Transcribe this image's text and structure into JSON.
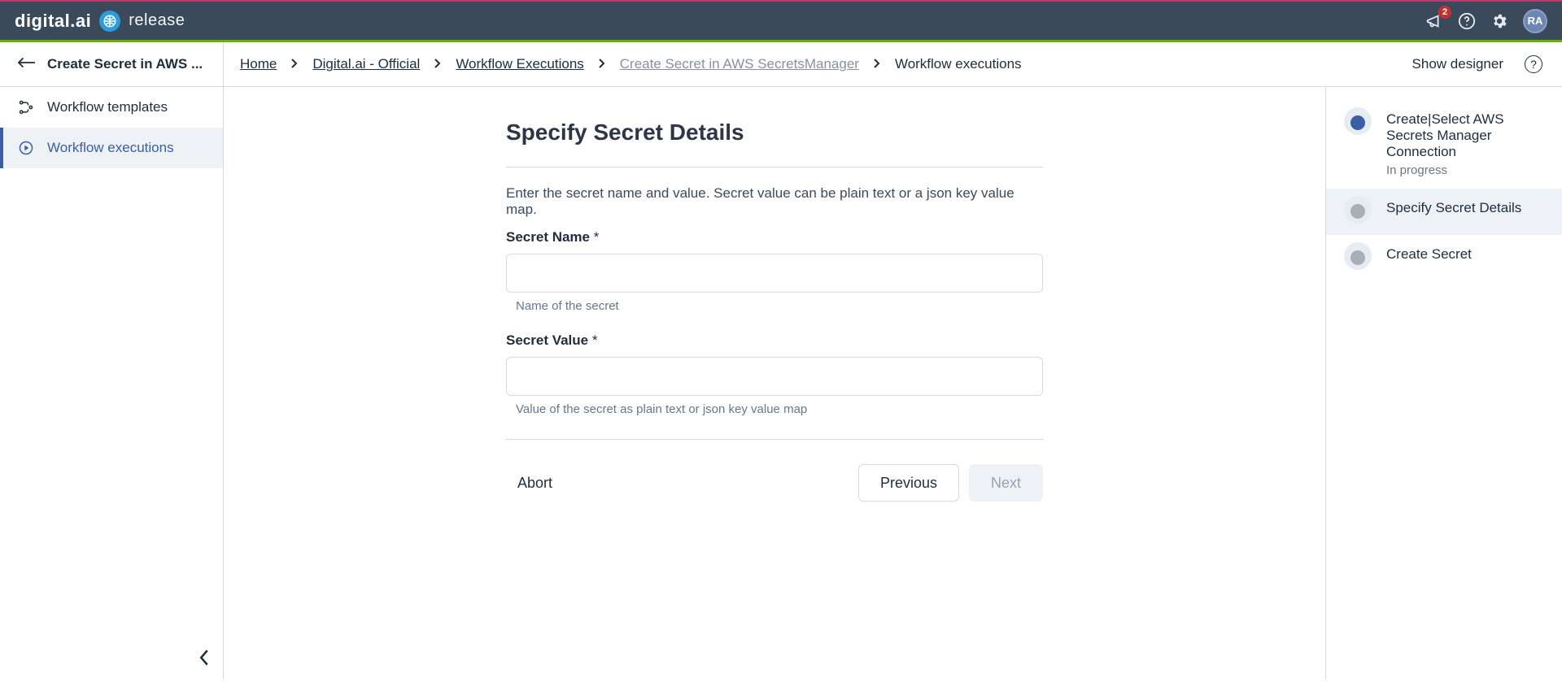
{
  "brand": {
    "name": "digital.ai",
    "sub": "release"
  },
  "topbar": {
    "notification_count": "2",
    "avatar_initials": "RA"
  },
  "subbar": {
    "title": "Create Secret in AWS ...",
    "show_designer": "Show designer"
  },
  "breadcrumbs": [
    {
      "label": "Home",
      "type": "link"
    },
    {
      "label": "Digital.ai - Official",
      "type": "link"
    },
    {
      "label": "Workflow Executions",
      "type": "link"
    },
    {
      "label": "Create Secret in AWS SecretsManager",
      "type": "muted"
    },
    {
      "label": "Workflow executions",
      "type": "current"
    }
  ],
  "sidebar": {
    "items": [
      {
        "label": "Workflow templates"
      },
      {
        "label": "Workflow executions"
      }
    ]
  },
  "form": {
    "title": "Specify Secret Details",
    "description": "Enter the secret name and value. Secret value can be plain text or a json key value map.",
    "fields": {
      "name": {
        "label": "Secret Name",
        "required_mark": "*",
        "help": "Name of the secret",
        "value": ""
      },
      "value": {
        "label": "Secret Value",
        "required_mark": "*",
        "help": "Value of the secret as plain text or json key value map",
        "value": ""
      }
    },
    "actions": {
      "abort": "Abort",
      "previous": "Previous",
      "next": "Next"
    }
  },
  "steps": [
    {
      "title": "Create|Select AWS Secrets Manager Connection",
      "sub": "In progress",
      "state": "done"
    },
    {
      "title": "Specify Secret Details",
      "sub": "",
      "state": "current"
    },
    {
      "title": "Create Secret",
      "sub": "",
      "state": "pending"
    }
  ]
}
